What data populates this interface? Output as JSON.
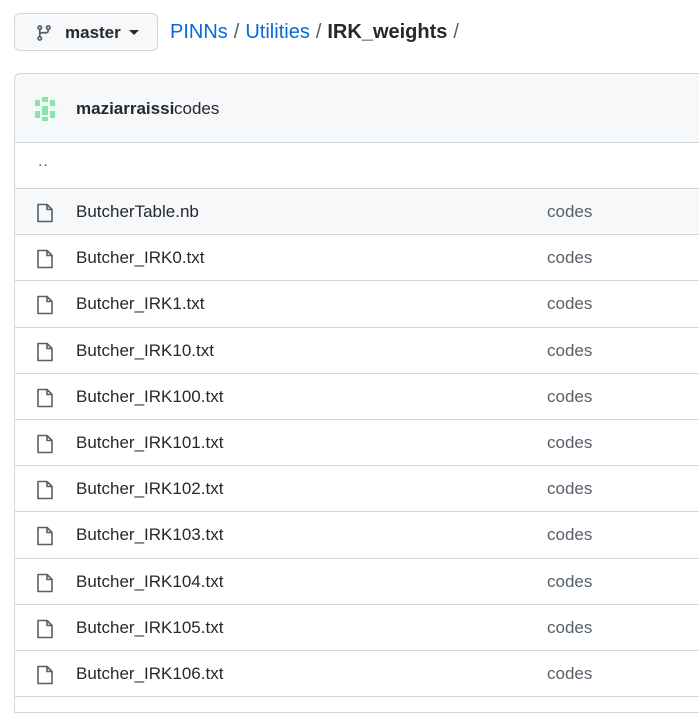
{
  "branch": {
    "name": "master",
    "icon": "git-branch-icon"
  },
  "breadcrumb": {
    "repo": "PINNs",
    "folder": "Utilities",
    "current": "IRK_weights",
    "separator": "/"
  },
  "commit": {
    "author": "maziarraissi",
    "message": "codes",
    "avatar_color": "#8fe0b0"
  },
  "parent_link": "..",
  "files": [
    {
      "name": "ButcherTable.nb",
      "commit": "codes",
      "icon": "file-icon"
    },
    {
      "name": "Butcher_IRK0.txt",
      "commit": "codes",
      "icon": "file-icon"
    },
    {
      "name": "Butcher_IRK1.txt",
      "commit": "codes",
      "icon": "file-icon"
    },
    {
      "name": "Butcher_IRK10.txt",
      "commit": "codes",
      "icon": "file-icon"
    },
    {
      "name": "Butcher_IRK100.txt",
      "commit": "codes",
      "icon": "file-icon"
    },
    {
      "name": "Butcher_IRK101.txt",
      "commit": "codes",
      "icon": "file-icon"
    },
    {
      "name": "Butcher_IRK102.txt",
      "commit": "codes",
      "icon": "file-icon"
    },
    {
      "name": "Butcher_IRK103.txt",
      "commit": "codes",
      "icon": "file-icon"
    },
    {
      "name": "Butcher_IRK104.txt",
      "commit": "codes",
      "icon": "file-icon"
    },
    {
      "name": "Butcher_IRK105.txt",
      "commit": "codes",
      "icon": "file-icon"
    },
    {
      "name": "Butcher_IRK106.txt",
      "commit": "codes",
      "icon": "file-icon"
    }
  ],
  "colors": {
    "link": "#0969da",
    "border": "#d0d7de",
    "header_bg": "#f6f8fa"
  }
}
